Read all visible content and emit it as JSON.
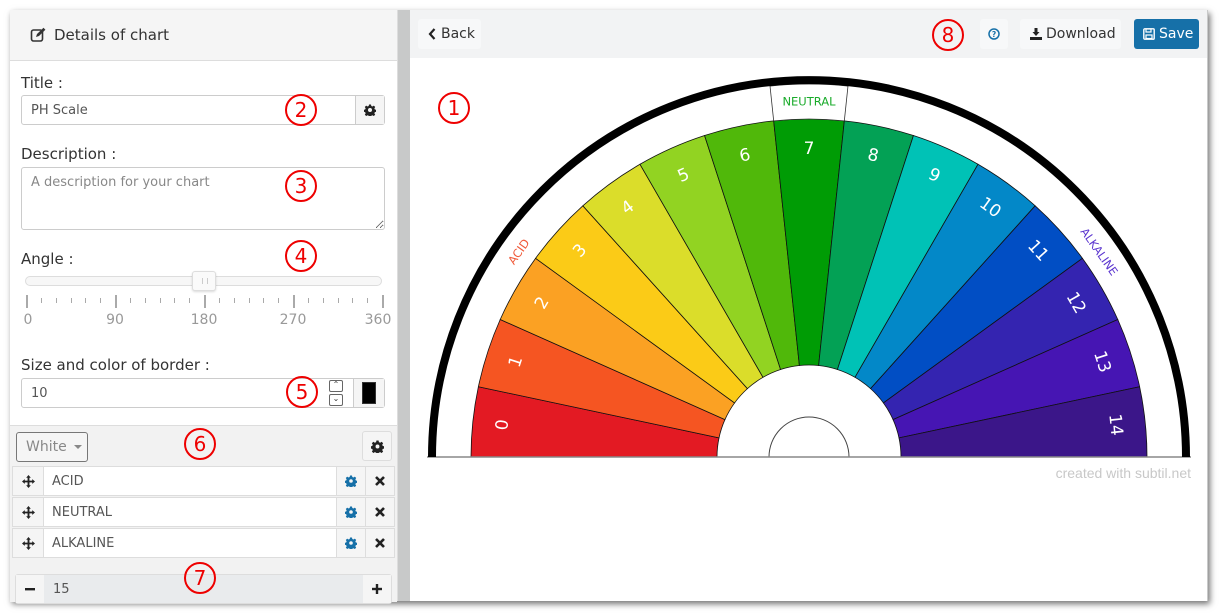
{
  "panel": {
    "header_title": "Details of chart",
    "header_icon": "edit-icon",
    "title_label": "Title :",
    "title_value": "PH Scale",
    "description_label": "Description :",
    "description_placeholder": "A description for your chart",
    "description_value": "",
    "angle_label": "Angle :",
    "angle_value": 180,
    "angle_min": 0,
    "angle_max": 360,
    "angle_tick_labels": [
      "0",
      "90",
      "180",
      "270",
      "360"
    ],
    "border_label": "Size and color of border :",
    "border_size": "10",
    "border_color": "#000000",
    "background_select": "White",
    "series": [
      {
        "label": "ACID"
      },
      {
        "label": "NEUTRAL"
      },
      {
        "label": "ALKALINE"
      }
    ],
    "segment_count": "15"
  },
  "toolbar": {
    "back_label": "Back",
    "help_icon": "question-circle-icon",
    "download_label": "Download",
    "save_label": "Save"
  },
  "annotations": [
    "1",
    "2",
    "3",
    "4",
    "5",
    "6",
    "7",
    "8"
  ],
  "watermark": "created with subtil.net",
  "chart_data": {
    "type": "pie",
    "title": "PH Scale",
    "subtype": "half-donut gauge",
    "angle": 180,
    "border_size": 10,
    "border_color": "#000000",
    "categories": [
      "0",
      "1",
      "2",
      "3",
      "4",
      "5",
      "6",
      "7",
      "8",
      "9",
      "10",
      "11",
      "12",
      "13",
      "14"
    ],
    "values": [
      1,
      1,
      1,
      1,
      1,
      1,
      1,
      1,
      1,
      1,
      1,
      1,
      1,
      1,
      1
    ],
    "colors": [
      "#e31a23",
      "#f55522",
      "#fba123",
      "#fbcb17",
      "#dbdd2a",
      "#92d322",
      "#50b80a",
      "#009c05",
      "#03a155",
      "#00c2b6",
      "#0388c8",
      "#014ec4",
      "#3424b0",
      "#4615b3",
      "#3b1689"
    ],
    "groups": [
      {
        "name": "ACID",
        "from": 0,
        "to": 6,
        "color": "#f05a3a"
      },
      {
        "name": "NEUTRAL",
        "from": 7,
        "to": 7,
        "color": "#1aab2b"
      },
      {
        "name": "ALKALINE",
        "from": 8,
        "to": 14,
        "color": "#5b35cf"
      }
    ]
  }
}
